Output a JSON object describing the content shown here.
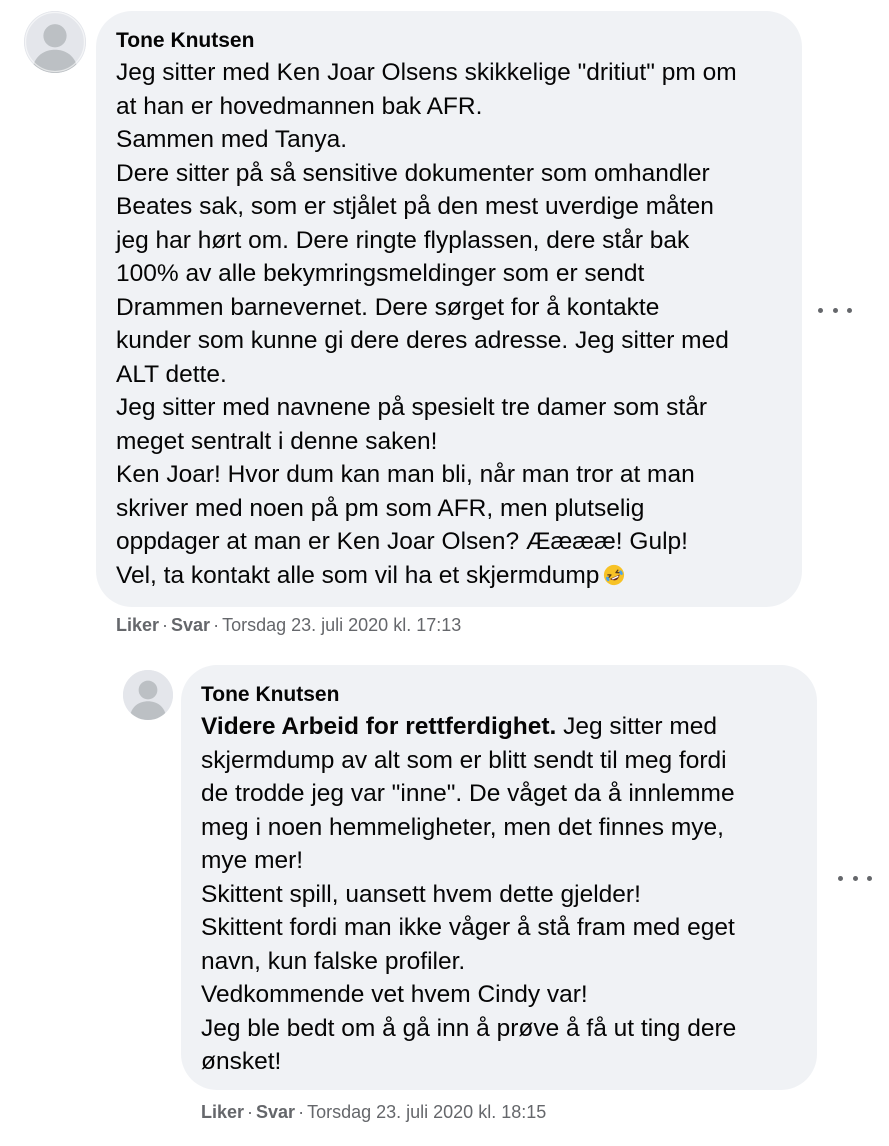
{
  "comments": [
    {
      "author": "Tone Knutsen",
      "lines": [
        "Jeg sitter med Ken Joar Olsens skikkelige \"dritiut\" pm om",
        "at han er hovedmannen bak AFR.",
        "Sammen med Tanya.",
        "Dere sitter på så sensitive dokumenter som omhandler",
        "Beates sak, som er stjålet på den mest uverdige måten",
        "jeg har hørt om. Dere ringte flyplassen, dere står bak",
        "100% av alle bekymringsmeldinger som er sendt",
        "Drammen barnevernet. Dere sørget for å kontakte",
        "kunder som kunne gi dere deres adresse. Jeg sitter med",
        "ALT dette.",
        "Jeg sitter med navnene på spesielt tre damer som står",
        "meget sentralt i denne saken!",
        "Ken Joar! Hvor dum kan man bli, når man tror at man",
        "skriver med noen på pm som AFR, men plutselig",
        "oppdager at man er Ken Joar Olsen? Ææææ! Gulp!",
        "Vel, ta kontakt alle som vil ha et skjermdump"
      ],
      "emoji": "rolling-on-floor-laughing-emoji",
      "like_label": "Liker",
      "reply_label": "Svar",
      "timestamp": "Torsdag 23. juli 2020 kl. 17:13",
      "separator": "·"
    },
    {
      "author": "Tone Knutsen",
      "bold_lead": "Videre Arbeid for rettferdighet.",
      "first_line_rest": " Jeg sitter med",
      "lines": [
        "skjermdump av alt som er blitt sendt til meg fordi",
        "de trodde jeg var \"inne\". De våget da å innlemme",
        "meg i noen hemmeligheter, men det finnes mye,",
        "mye mer!",
        "Skittent spill, uansett hvem dette gjelder!",
        "Skittent fordi man ikke våger å stå fram med eget",
        "navn, kun falske profiler.",
        "Vedkommende vet hvem Cindy var!",
        "Jeg ble bedt om å gå inn å prøve å få ut ting dere",
        "ønsket!"
      ],
      "like_label": "Liker",
      "reply_label": "Svar",
      "timestamp": "Torsdag 23. juli 2020 kl. 18:15",
      "separator": "·"
    }
  ],
  "icons": {
    "avatar": "default-profile-avatar",
    "more": "more-options-icon"
  },
  "colors": {
    "bubble": "#f0f2f5",
    "meta_text": "#65676b",
    "avatar_bg": "#e4e6eb",
    "avatar_fg": "#bcc0c4"
  }
}
